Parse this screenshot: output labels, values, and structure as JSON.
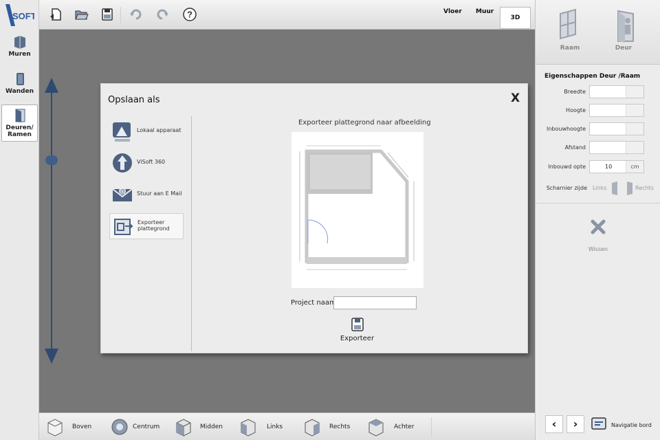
{
  "app": {
    "logo_text": "ViSOFT",
    "brand_color": "#3a5a8a"
  },
  "leftbar": {
    "tools": [
      {
        "label": "Muren",
        "icon": "wall-icon"
      },
      {
        "label": "Wanden",
        "icon": "door-panel-icon"
      },
      {
        "label": "Deuren/\nRamen",
        "icon": "door-window-icon",
        "active": true
      }
    ]
  },
  "toolbar": {
    "buttons": [
      "new-file-icon",
      "open-folder-icon",
      "save-icon",
      "undo-icon",
      "redo-icon",
      "help-icon"
    ],
    "tabs": [
      {
        "label": "Vloer"
      },
      {
        "label": "Muur"
      },
      {
        "label": "3D",
        "active": true
      }
    ]
  },
  "rightpanel": {
    "buttons": [
      {
        "label": "Raam",
        "icon": "window-icon"
      },
      {
        "label": "Deur",
        "icon": "door-icon"
      }
    ],
    "title": "Eigenschappen Deur /Raam",
    "fields": [
      {
        "label": "Breedte",
        "value": "",
        "unit": ""
      },
      {
        "label": "Hoogte",
        "value": "",
        "unit": ""
      },
      {
        "label": "Inbouwhoogte",
        "value": "",
        "unit": ""
      },
      {
        "label": "Afstand",
        "value": "",
        "unit": ""
      },
      {
        "label": "Inbouwd opte",
        "value": "10",
        "unit": "cm"
      }
    ],
    "hinge": {
      "label": "Scharnier zijde",
      "left": "Links",
      "right": "Rechts"
    },
    "delete_label": "Wissen",
    "nav_label": "Navigatie bord"
  },
  "bottombar": {
    "views": [
      {
        "label": "Boven",
        "icon": "top-view-icon"
      },
      {
        "label": "Centrum",
        "icon": "center-view-icon"
      },
      {
        "label": "Midden",
        "icon": "middle-view-icon"
      },
      {
        "label": "Links",
        "icon": "left-view-icon"
      },
      {
        "label": "Rechts",
        "icon": "right-view-icon"
      },
      {
        "label": "Achter",
        "icon": "back-view-icon"
      }
    ]
  },
  "dialog": {
    "title": "Opslaan als",
    "close_label": "X",
    "options": [
      {
        "label": "Lokaal apparaat",
        "icon": "local-device-icon"
      },
      {
        "label": "ViSoft 360",
        "icon": "visoft-360-icon"
      },
      {
        "label": "Stuur aan E Mail",
        "icon": "email-icon"
      },
      {
        "label": "Exporteer\nplattegrond",
        "icon": "export-floorplan-icon",
        "selected": true
      }
    ],
    "export_heading": "Exporteer plattegrond naar afbeelding",
    "project_label": "Project naam",
    "project_value": "",
    "export_button": "Exporteer"
  }
}
